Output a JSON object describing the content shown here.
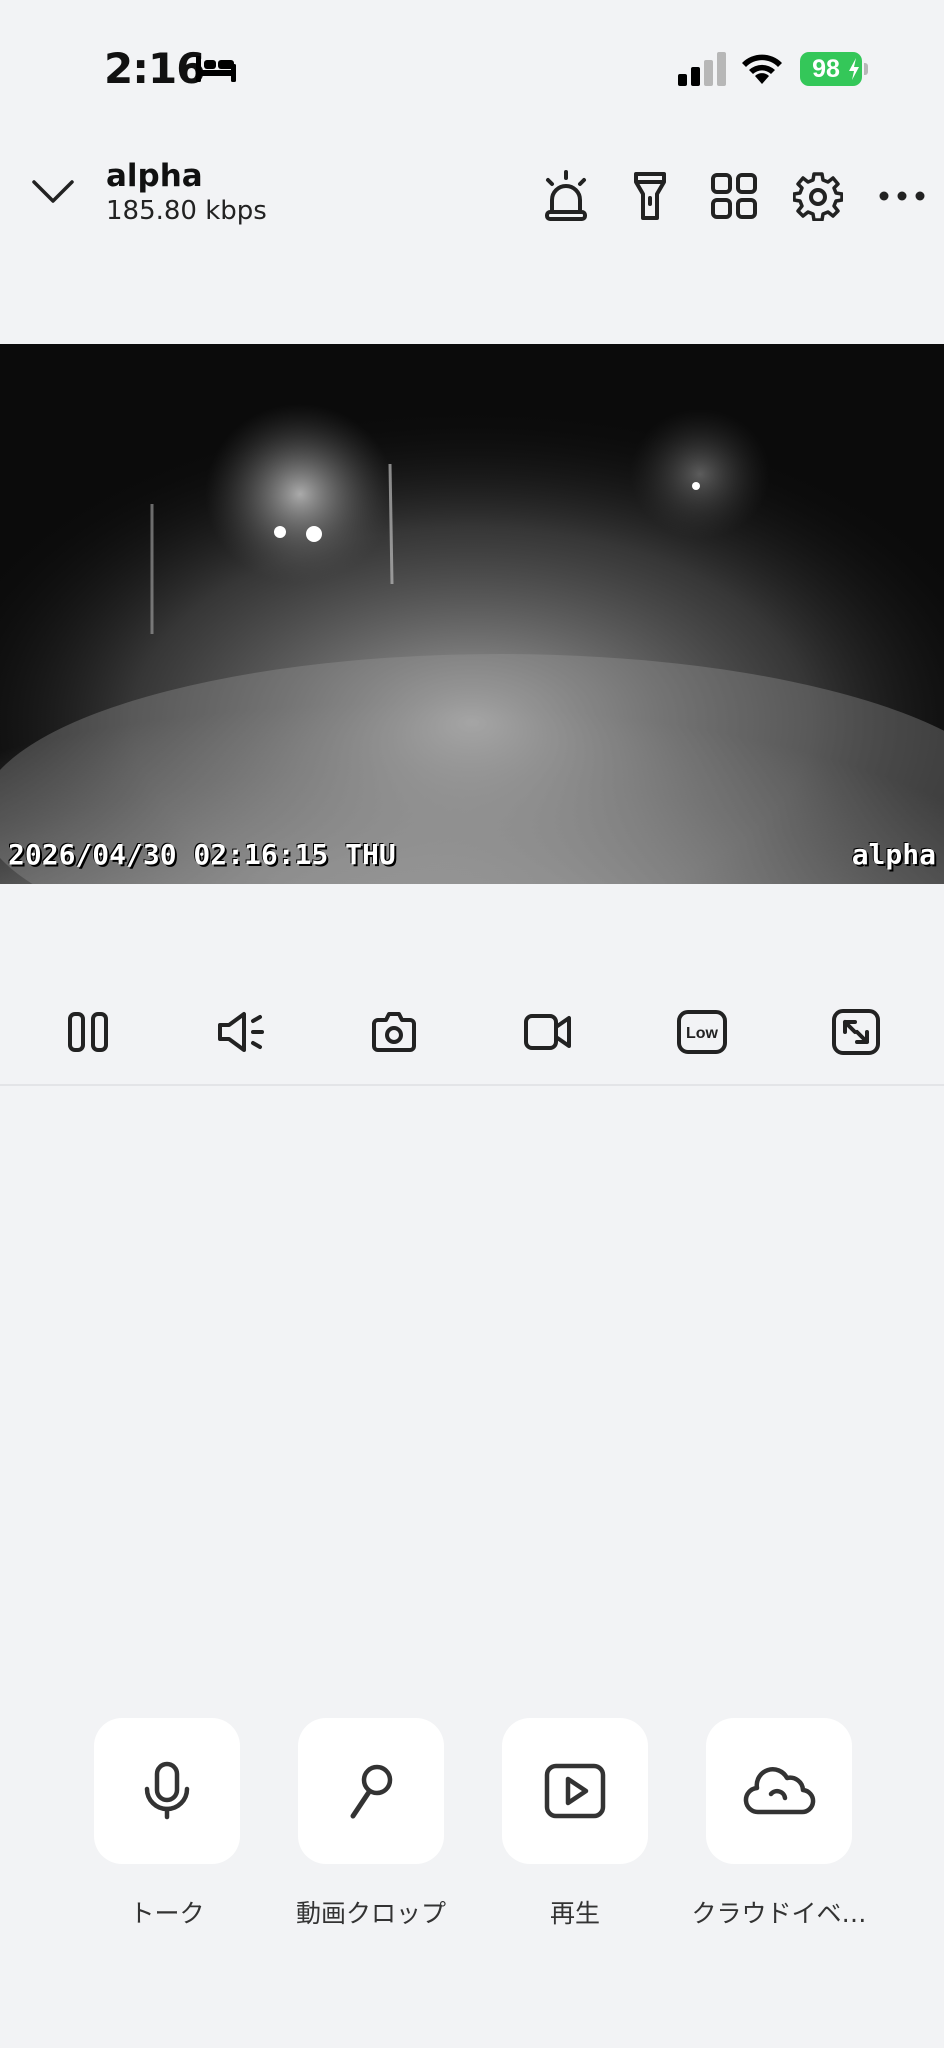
{
  "status_bar": {
    "time": "2:16",
    "battery_level": "98",
    "icons": [
      "bed-icon",
      "signal-icon",
      "wifi-icon",
      "battery-icon"
    ],
    "battery_color": "#34c759"
  },
  "header": {
    "device_name": "alpha",
    "bitrate": "185.80 kbps",
    "icons": [
      "chevron-down-icon",
      "siren-icon",
      "flashlight-icon",
      "grid-icon",
      "gear-icon",
      "more-icon"
    ]
  },
  "video": {
    "timestamp": "2026/04/30 02:16:15 THU",
    "camera_label": "alpha"
  },
  "controls": [
    "pause-icon",
    "speaker-icon",
    "camera-icon",
    "video-record-icon",
    "low-quality-icon",
    "fullscreen-icon"
  ],
  "controls_quality_text": "Low",
  "actions": [
    {
      "label": "トーク",
      "icon": "microphone-icon"
    },
    {
      "label": "動画クロップ",
      "icon": "magnifier-icon"
    },
    {
      "label": "再生",
      "icon": "play-icon"
    },
    {
      "label": "クラウドイベ…",
      "icon": "cloud-icon"
    }
  ]
}
